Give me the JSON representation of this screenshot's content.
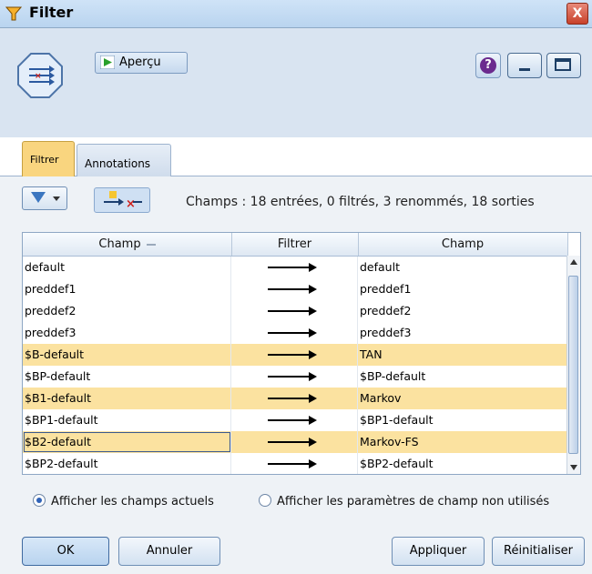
{
  "window": {
    "title": "Filter",
    "close_label": "X"
  },
  "toolbar": {
    "preview_label": "Aperçu",
    "help_label": "?"
  },
  "tabs": [
    {
      "label": "Filtrer"
    },
    {
      "label": "Annotations"
    }
  ],
  "summary": "Champs : 18 entrées, 0 filtrés, 3 renommés, 18 sorties",
  "table": {
    "headers": [
      "Champ",
      "Filtrer",
      "Champ"
    ],
    "rows": [
      {
        "input": "default",
        "output": "default",
        "renamed": false
      },
      {
        "input": "preddef1",
        "output": "preddef1",
        "renamed": false
      },
      {
        "input": "preddef2",
        "output": "preddef2",
        "renamed": false
      },
      {
        "input": "preddef3",
        "output": "preddef3",
        "renamed": false
      },
      {
        "input": "$B-default",
        "output": "TAN",
        "renamed": true
      },
      {
        "input": "$BP-default",
        "output": "$BP-default",
        "renamed": false
      },
      {
        "input": "$B1-default",
        "output": "Markov",
        "renamed": true
      },
      {
        "input": "$BP1-default",
        "output": "$BP1-default",
        "renamed": false
      },
      {
        "input": "$B2-default",
        "output": "Markov-FS",
        "renamed": true
      },
      {
        "input": "$BP2-default",
        "output": "$BP2-default",
        "renamed": false
      }
    ]
  },
  "options": {
    "current_label": "Afficher les champs actuels",
    "unused_label": "Afficher les paramètres de champ non utilisés",
    "selected": "current"
  },
  "buttons": {
    "ok": "OK",
    "cancel": "Annuler",
    "apply": "Appliquer",
    "reset": "Réinitialiser"
  },
  "colors": {
    "accent": "#f9d57f",
    "selection": "#fbe2a0",
    "chrome": "#d9e4f1"
  },
  "icons": {
    "title": "filter-node-icon",
    "node": "filter-node-icon",
    "preview": "play-icon",
    "filter_dropdown": "funnel-icon",
    "rename": "rename-fields-icon"
  }
}
